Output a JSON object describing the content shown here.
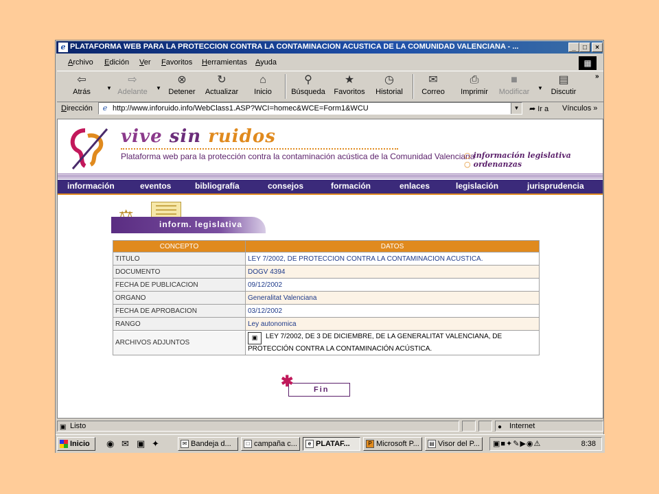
{
  "window": {
    "title": "PLATAFORMA WEB PARA LA PROTECCION CONTRA LA CONTAMINACION ACUSTICA DE LA COMUNIDAD VALENCIANA - ...",
    "min": "_",
    "max": "□",
    "close": "×"
  },
  "menu": [
    "Archivo",
    "Edición",
    "Ver",
    "Favoritos",
    "Herramientas",
    "Ayuda"
  ],
  "toolbar": {
    "back": "Atrás",
    "forward": "Adelante",
    "stop": "Detener",
    "refresh": "Actualizar",
    "home": "Inicio",
    "search": "Búsqueda",
    "favorites": "Favoritos",
    "history": "Historial",
    "mail": "Correo",
    "print": "Imprimir",
    "edit": "Modificar",
    "discuss": "Discutir"
  },
  "address": {
    "label": "Dirección",
    "url": "http://www.inforuido.info/WebClass1.ASP?WCI=homec&WCE=Form1&WCU",
    "go": "Ir a",
    "links": "Vínculos"
  },
  "site": {
    "brand1": "vive",
    "brand2": "sin",
    "brand3": "ruidos",
    "subtitle": "Plataforma web para la protección contra la contaminación acústica de la Comunidad Valenciana",
    "side1": "información legislativa",
    "side2": "ordenanzas",
    "nav": [
      "información",
      "eventos",
      "bibliografía",
      "consejos",
      "formación",
      "enlaces",
      "legislación",
      "jurisprudencia"
    ],
    "section": "inform. legislativa"
  },
  "table": {
    "headers": [
      "CONCEPTO",
      "DATOS"
    ],
    "rows": [
      {
        "k": "TITULO",
        "v": "LEY 7/2002, DE PROTECCION CONTRA LA CONTAMINACION ACUSTICA."
      },
      {
        "k": "DOCUMENTO",
        "v": "DOGV 4394"
      },
      {
        "k": "FECHA DE PUBLICACION",
        "v": "09/12/2002"
      },
      {
        "k": "ORGANO",
        "v": "Generalitat Valenciana"
      },
      {
        "k": "FECHA DE APROBACION",
        "v": "03/12/2002"
      },
      {
        "k": "RANGO",
        "v": "Ley autonomica"
      }
    ],
    "attach_label": "ARCHIVOS ADJUNTOS",
    "attach_text": "LEY 7/2002, DE 3 DE DICIEMBRE, DE LA GENERALITAT VALENCIANA, DE PROTECCIÓN CONTRA LA CONTAMINACIÓN ACÚSTICA."
  },
  "fin": "Fin",
  "status": {
    "text": "Listo",
    "zone": "Internet"
  },
  "taskbar": {
    "start": "Inicio",
    "tasks": [
      "Bandeja d...",
      "campaña c...",
      "PLATAF...",
      "Microsoft P...",
      "Visor del P..."
    ],
    "clock": "8:38"
  }
}
